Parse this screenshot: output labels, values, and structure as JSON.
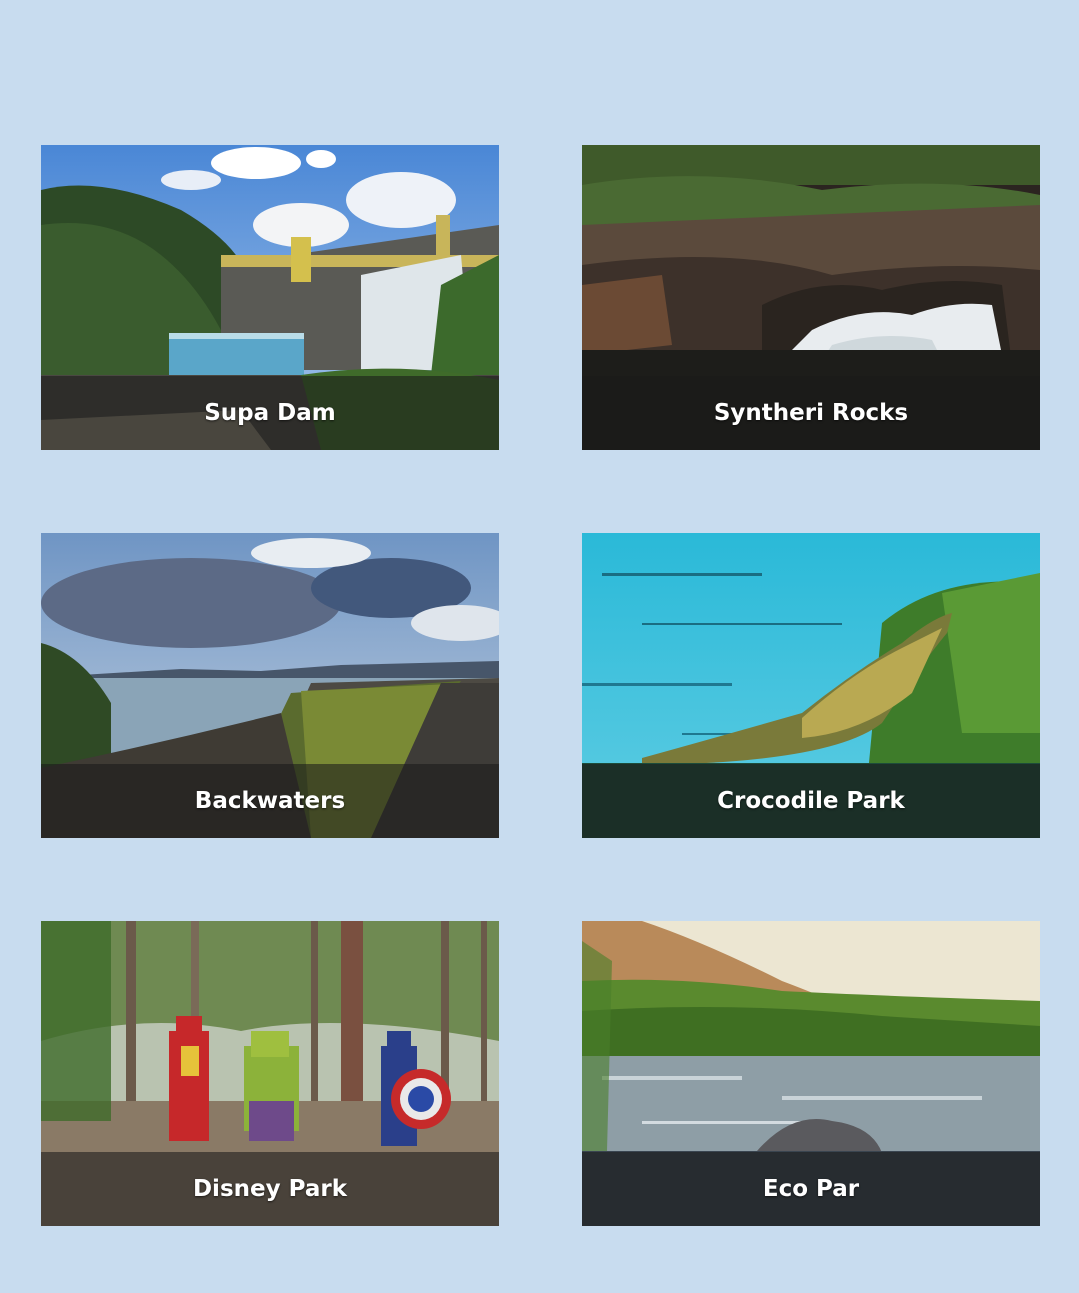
{
  "page": {
    "background": "#c8dcef"
  },
  "places": [
    {
      "title": "Supa Dam",
      "image": "dam-photo"
    },
    {
      "title": "Syntheri Rocks",
      "image": "waterfall-rocks-photo"
    },
    {
      "title": "Backwaters",
      "image": "backwaters-embankment-photo"
    },
    {
      "title": "Crocodile Park",
      "image": "crocodile-photo"
    },
    {
      "title": "Disney Park",
      "image": "superhero-statues-photo"
    },
    {
      "title": "Eco Par",
      "image": "river-rapids-photo"
    }
  ]
}
